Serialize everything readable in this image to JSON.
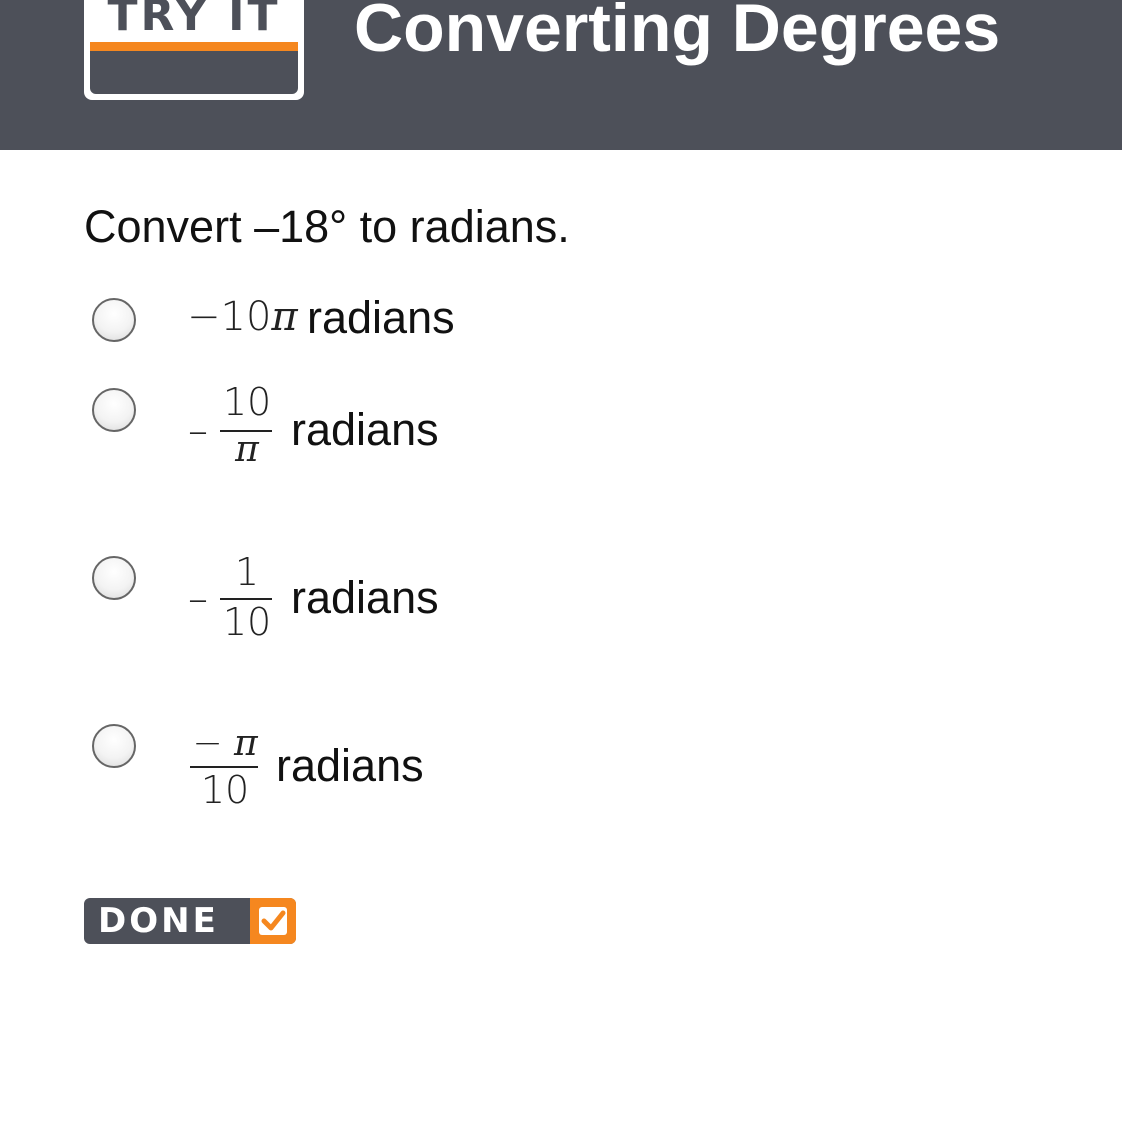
{
  "header": {
    "badge": "TRY IT",
    "title": "Converting Degrees"
  },
  "question": "Convert –18° to radians.",
  "options": [
    {
      "minus": "−",
      "num": "10",
      "pi": "π",
      "unit": "radians"
    },
    {
      "minus": "–",
      "num": "10",
      "den": "π",
      "unit": "radians"
    },
    {
      "minus": "–",
      "num": "1",
      "den": "10",
      "unit": "radians"
    },
    {
      "minus": "−",
      "num": "π",
      "den": "10",
      "unit": "radians"
    }
  ],
  "done": {
    "label": "DONE",
    "check": "checkmark-icon"
  },
  "colors": {
    "header_bg": "#4d5059",
    "accent": "#f5871f"
  }
}
